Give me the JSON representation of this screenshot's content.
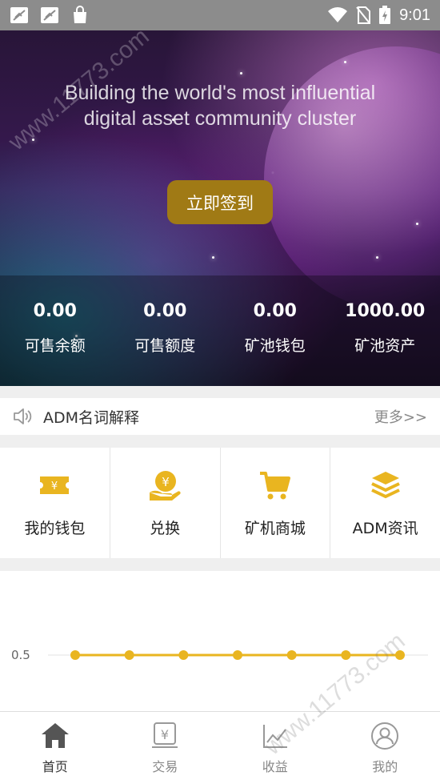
{
  "status_bar": {
    "time": "9:01"
  },
  "hero": {
    "title_line1": "Building the world's most influential",
    "title_line2": "digital asset community cluster",
    "checkin_label": "立即签到",
    "stats": [
      {
        "value": "0.00",
        "label": "可售余额"
      },
      {
        "value": "0.00",
        "label": "可售额度"
      },
      {
        "value": "0.00",
        "label": "矿池钱包"
      },
      {
        "value": "1000.00",
        "label": "矿池资产"
      }
    ]
  },
  "notice": {
    "title": "ADM名词解释",
    "more": "更多>>"
  },
  "grid": [
    {
      "label": "我的钱包",
      "icon": "ticket-icon"
    },
    {
      "label": "兑换",
      "icon": "yen-coin-hand-icon"
    },
    {
      "label": "矿机商城",
      "icon": "cart-icon"
    },
    {
      "label": "ADM资讯",
      "icon": "layers-icon"
    }
  ],
  "colors": {
    "accent": "#e9b520",
    "checkin_bg": "#a07a15"
  },
  "chart_data": {
    "type": "line",
    "x": [
      1,
      2,
      3,
      4,
      5,
      6,
      7
    ],
    "series": [
      {
        "values": [
          0.5,
          0.5,
          0.5,
          0.5,
          0.5,
          0.5,
          0.5
        ]
      }
    ],
    "yticks": [
      "0.5"
    ],
    "ylim": [
      0,
      1
    ],
    "grid": true,
    "color": "#e9b520"
  },
  "bottom_nav": [
    {
      "label": "首页",
      "icon": "home-icon",
      "active": true
    },
    {
      "label": "交易",
      "icon": "yen-trade-icon",
      "active": false
    },
    {
      "label": "收益",
      "icon": "chart-icon",
      "active": false
    },
    {
      "label": "我的",
      "icon": "user-icon",
      "active": false
    }
  ],
  "watermark": "www.11773.com"
}
